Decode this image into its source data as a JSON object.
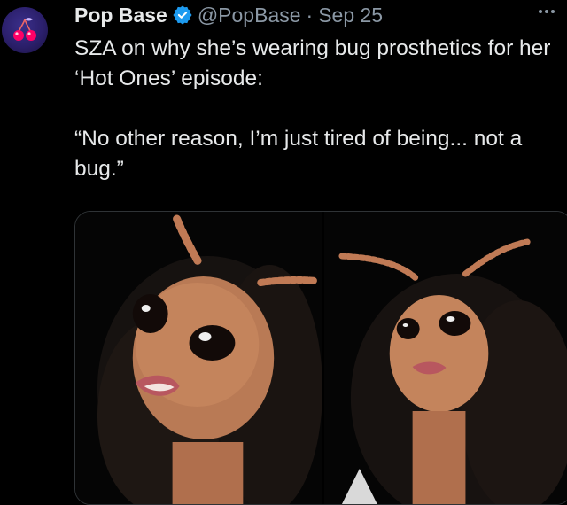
{
  "tweet": {
    "author": {
      "name": "Pop Base",
      "handle": "@PopBase",
      "verified": true,
      "avatar_icon": "cherry-avatar-icon"
    },
    "separator": "·",
    "date": "Sep 25",
    "more_icon": "more-dots-icon",
    "text": "SZA on why she’s wearing bug prosthetics for her ‘Hot Ones’ episode:\n\n“No other reason, I’m just tired of being... not a bug.”",
    "media": {
      "images": [
        {
          "description_icon": "bug-prosthetic-photo-left"
        },
        {
          "description_icon": "bug-prosthetic-photo-right"
        }
      ]
    }
  },
  "colors": {
    "background": "#000000",
    "text": "#e7e9ea",
    "secondary": "#8b98a5",
    "verified": "#1d9bf0",
    "avatar": "#2b1f6b"
  }
}
